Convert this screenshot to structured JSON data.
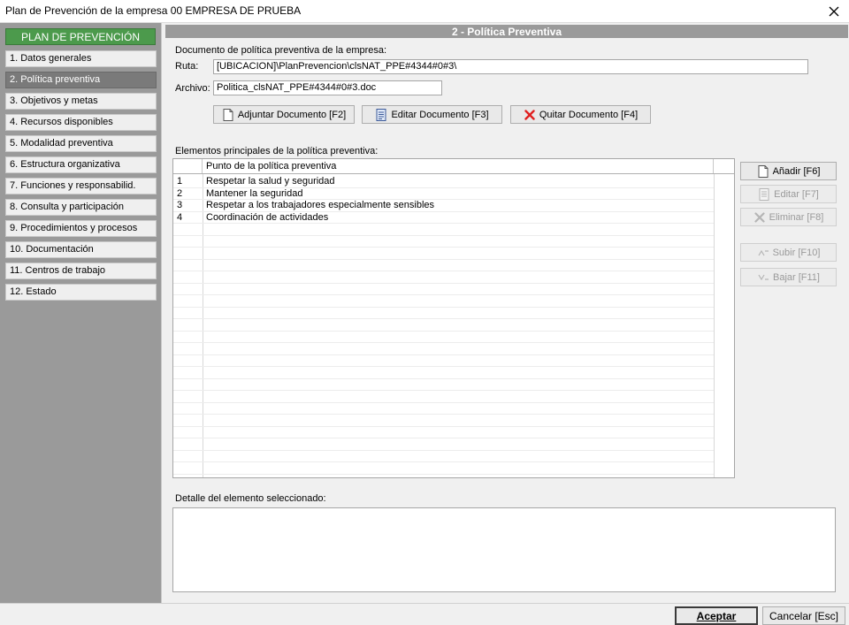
{
  "window": {
    "title": "Plan de Prevención de la empresa 00 EMPRESA DE PRUEBA",
    "close_icon": "close-icon"
  },
  "sidebar": {
    "header": "PLAN DE PREVENCIÓN",
    "items": [
      {
        "label": "1. Datos generales"
      },
      {
        "label": "2. Política preventiva",
        "active": true
      },
      {
        "label": "3. Objetivos y metas"
      },
      {
        "label": "4. Recursos disponibles"
      },
      {
        "label": "5. Modalidad preventiva"
      },
      {
        "label": "6. Estructura organizativa"
      },
      {
        "label": "7. Funciones y responsabilid."
      },
      {
        "label": "8. Consulta y participación"
      },
      {
        "label": "9. Procedimientos y procesos"
      },
      {
        "label": "10. Documentación"
      },
      {
        "label": "11. Centros de trabajo"
      },
      {
        "label": "12. Estado"
      }
    ]
  },
  "main": {
    "header": "2 - Política Preventiva",
    "doc_section_label": "Documento de política preventiva de la empresa:",
    "ruta_label": "Ruta:",
    "ruta_value": "[UBICACION]\\PlanPrevencion\\clsNAT_PPE#4344#0#3\\",
    "archivo_label": "Archivo:",
    "archivo_value": "Politica_clsNAT_PPE#4344#0#3.doc",
    "buttons": {
      "adjuntar": "Adjuntar Documento  [F2]",
      "editar_doc": "Editar Documento  [F3]",
      "quitar": "Quitar Documento  [F4]"
    },
    "elements_label": "Elementos principales de la política preventiva:",
    "grid": {
      "column_header": "Punto de la política preventiva",
      "rows": [
        {
          "num": "1",
          "text": "Respetar la salud y seguridad"
        },
        {
          "num": "2",
          "text": "Mantener la seguridad"
        },
        {
          "num": "3",
          "text": "Respetar a los trabajadores especialmente sensibles"
        },
        {
          "num": "4",
          "text": "Coordinación de actividades"
        }
      ]
    },
    "side_buttons": {
      "anadir": "Añadir  [F6]",
      "editar": "Editar   [F7]",
      "eliminar": "Eliminar [F8]",
      "subir": "Subir  [F10]",
      "bajar": "Bajar  [F11]"
    },
    "detail_label": "Detalle del elemento seleccionado:"
  },
  "footer": {
    "accept": "Aceptar",
    "cancel": "Cancelar [Esc]"
  },
  "colors": {
    "sidebar_header": "#4c9a4c",
    "sidebar_bg": "#9a9a9a",
    "active_item": "#7a7a7a",
    "remove_icon": "#e02020"
  }
}
